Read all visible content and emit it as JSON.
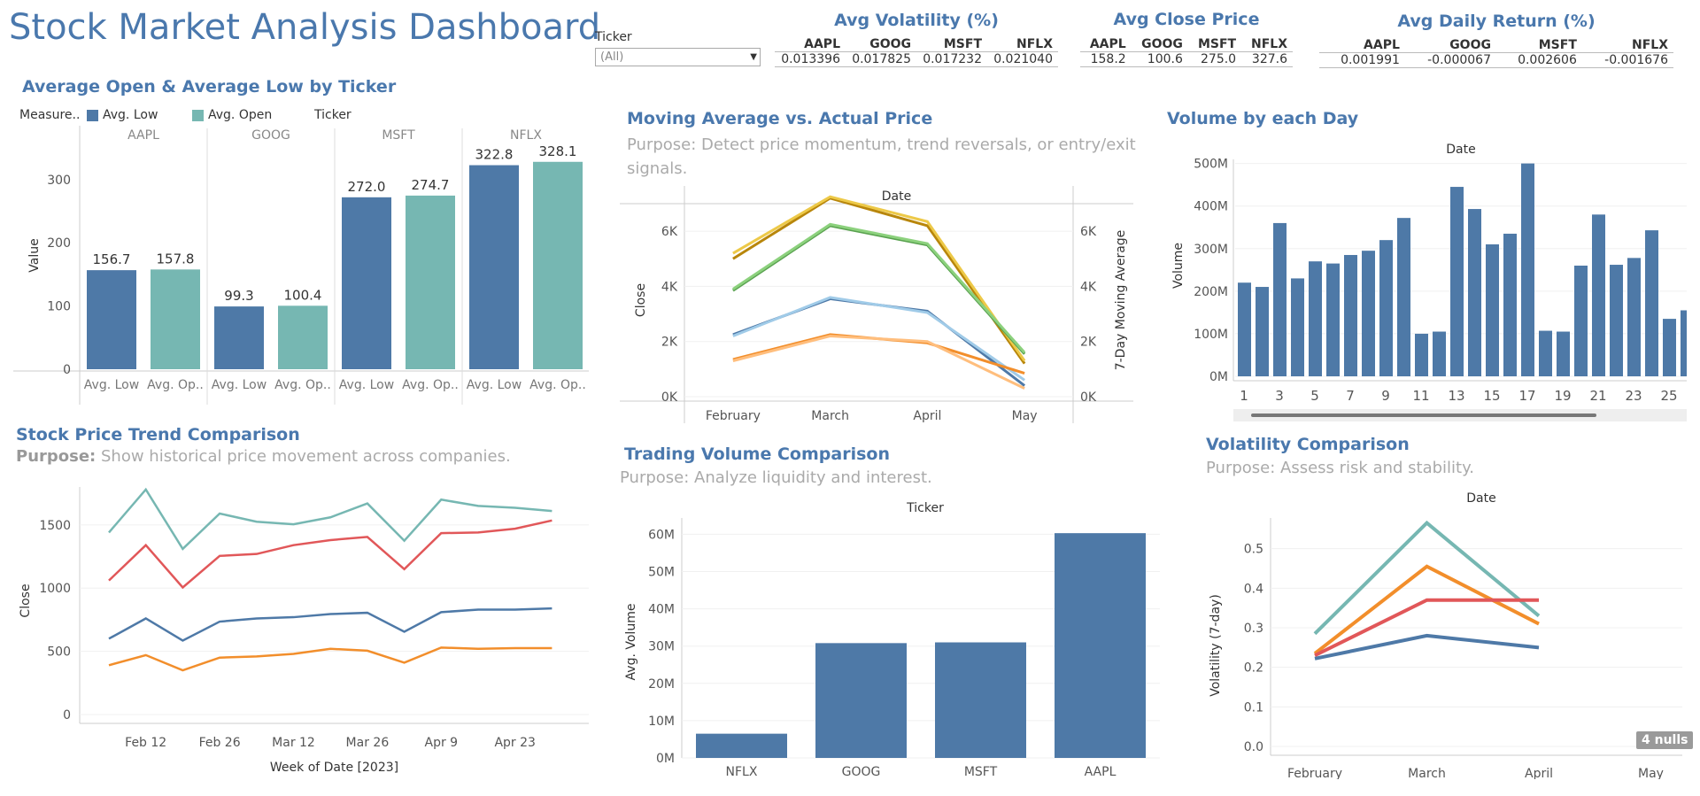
{
  "dashboard_title": "Stock Market Analysis Dashboard",
  "filter": {
    "label": "Ticker",
    "value": "(All)"
  },
  "kpis": {
    "volatility": {
      "title": "Avg Volatility (%)",
      "headers": [
        "AAPL",
        "GOOG",
        "MSFT",
        "NFLX"
      ],
      "values": [
        "0.013396",
        "0.017825",
        "0.017232",
        "0.021040"
      ]
    },
    "close": {
      "title": "Avg Close Price",
      "headers": [
        "AAPL",
        "GOOG",
        "MSFT",
        "NFLX"
      ],
      "values": [
        "158.2",
        "100.6",
        "275.0",
        "327.6"
      ]
    },
    "return": {
      "title": "Avg Daily Return (%)",
      "headers": [
        "AAPL",
        "GOOG",
        "MSFT",
        "NFLX"
      ],
      "values": [
        "0.001991",
        "-0.000067",
        "0.002606",
        "-0.001676"
      ]
    }
  },
  "colors": {
    "blue": "#4e79a7",
    "teal": "#76b7b2",
    "orange": "#f28e2b",
    "red": "#e15759",
    "green": "#59a14f",
    "gold": "#edc948",
    "brown": "#b07aa1",
    "title": "#4a78ad"
  },
  "chart_data": [
    {
      "id": "open_low",
      "type": "bar",
      "title": "Average Open & Average Low by Ticker",
      "legend_title": "Measure..",
      "column_header": "Ticker",
      "legend": [
        "Avg. Low",
        "Avg. Open"
      ],
      "ylabel": "Value",
      "ylim": [
        0,
        360
      ],
      "yticks": [
        0,
        100,
        200,
        300
      ],
      "categories": [
        "AAPL",
        "GOOG",
        "MSFT",
        "NFLX"
      ],
      "sub_labels": [
        "Avg. Low",
        "Avg. Op.."
      ],
      "series": [
        {
          "name": "Avg. Low",
          "values": [
            156.7,
            99.3,
            272.0,
            322.8
          ]
        },
        {
          "name": "Avg. Open",
          "values": [
            157.8,
            100.4,
            274.7,
            328.1
          ]
        }
      ]
    },
    {
      "id": "moving_avg",
      "type": "line",
      "title": "Moving Average vs. Actual Price",
      "purpose": "Purpose: Detect price momentum, trend reversals, or entry/exit signals.",
      "xlabel": "Date",
      "ylabel": "Close",
      "ylabel_right": "7-Day Moving Average",
      "categories": [
        "February",
        "March",
        "April",
        "May"
      ],
      "ylim": [
        0,
        7000
      ],
      "yticks": [
        0,
        2000,
        4000,
        6000
      ],
      "ytick_labels": [
        "0K",
        "2K",
        "4K",
        "6K"
      ],
      "series": [
        {
          "values": [
            5000,
            7200,
            6200,
            1200
          ]
        },
        {
          "values": [
            5200,
            7250,
            6350,
            1300
          ]
        },
        {
          "values": [
            3850,
            6200,
            5500,
            1550
          ]
        },
        {
          "values": [
            3900,
            6250,
            5550,
            1600
          ]
        },
        {
          "values": [
            2250,
            3550,
            3100,
            400
          ]
        },
        {
          "values": [
            2200,
            3600,
            3050,
            600
          ]
        },
        {
          "values": [
            1350,
            2250,
            1950,
            850
          ]
        },
        {
          "values": [
            1300,
            2200,
            2000,
            300
          ]
        }
      ]
    },
    {
      "id": "volume_day",
      "type": "bar",
      "title": "Volume by each Day",
      "xlabel": "Date",
      "ylabel": "Volume",
      "ylim": [
        0,
        520
      ],
      "yticks": [
        0,
        100,
        200,
        300,
        400,
        500
      ],
      "ytick_labels": [
        "0M",
        "100M",
        "200M",
        "300M",
        "400M",
        "500M"
      ],
      "categories": [
        "1",
        "2",
        "3",
        "4",
        "5",
        "6",
        "7",
        "8",
        "9",
        "10",
        "11",
        "12",
        "13",
        "14",
        "15",
        "16",
        "17",
        "18",
        "19",
        "20",
        "21",
        "22",
        "23",
        "24",
        "25",
        "26"
      ],
      "tick_labels": [
        "1",
        "3",
        "5",
        "7",
        "9",
        "11",
        "13",
        "15",
        "17",
        "19",
        "21",
        "23",
        "25"
      ],
      "values": [
        220,
        210,
        360,
        230,
        270,
        265,
        285,
        295,
        320,
        372,
        100,
        105,
        445,
        393,
        310,
        335,
        500,
        107,
        105,
        260,
        380,
        262,
        278,
        343,
        135,
        155
      ]
    },
    {
      "id": "price_trend",
      "type": "line",
      "title": "Stock Price Trend Comparison",
      "purpose_label": "Purpose:",
      "purpose": "Show historical price movement across companies.",
      "xlabel": "Week of Date [2023]",
      "ylabel": "Close",
      "ylim": [
        0,
        1800
      ],
      "yticks": [
        0,
        500,
        1000,
        1500
      ],
      "tick_labels": [
        "Feb 12",
        "Feb 26",
        "Mar 12",
        "Mar 26",
        "Apr 9",
        "Apr 23"
      ],
      "series": [
        {
          "values": [
            1440,
            1780,
            1310,
            1590,
            1525,
            1505,
            1560,
            1670,
            1375,
            1700,
            1650,
            1635,
            1610
          ]
        },
        {
          "values": [
            1060,
            1340,
            1005,
            1255,
            1270,
            1340,
            1380,
            1405,
            1150,
            1435,
            1440,
            1470,
            1535
          ]
        },
        {
          "values": [
            600,
            760,
            585,
            735,
            760,
            770,
            795,
            805,
            655,
            810,
            830,
            830,
            840
          ]
        },
        {
          "values": [
            390,
            470,
            350,
            450,
            460,
            480,
            520,
            505,
            410,
            530,
            520,
            525,
            525
          ]
        }
      ]
    },
    {
      "id": "trading_volume",
      "type": "bar",
      "title": "Trading Volume Comparison",
      "purpose": "Purpose: Analyze liquidity and interest.",
      "xlabel": "Ticker",
      "ylabel": "Avg. Volume",
      "ylim": [
        0,
        62
      ],
      "yticks": [
        0,
        10,
        20,
        30,
        40,
        50,
        60
      ],
      "ytick_labels": [
        "0M",
        "10M",
        "20M",
        "30M",
        "40M",
        "50M",
        "60M"
      ],
      "categories": [
        "NFLX",
        "GOOG",
        "MSFT",
        "AAPL"
      ],
      "values": [
        6.5,
        30.8,
        31.0,
        60.3
      ]
    },
    {
      "id": "volatility",
      "type": "line",
      "title": "Volatility Comparison",
      "purpose": "Purpose: Assess risk and stability.",
      "xlabel": "Date",
      "ylabel": "Volatility (7-day)",
      "ylim": [
        0,
        0.6
      ],
      "yticks": [
        0.0,
        0.1,
        0.2,
        0.3,
        0.4,
        0.5
      ],
      "ytick_labels": [
        "0.0",
        "0.1",
        "0.2",
        "0.3",
        "0.4",
        "0.5"
      ],
      "categories": [
        "February",
        "March",
        "April",
        "May"
      ],
      "note": "4 nulls",
      "series": [
        {
          "values": [
            0.285,
            0.565,
            0.33
          ]
        },
        {
          "values": [
            0.235,
            0.455,
            0.31
          ]
        },
        {
          "values": [
            0.23,
            0.37,
            0.37
          ]
        },
        {
          "values": [
            0.222,
            0.28,
            0.25
          ]
        }
      ]
    }
  ]
}
